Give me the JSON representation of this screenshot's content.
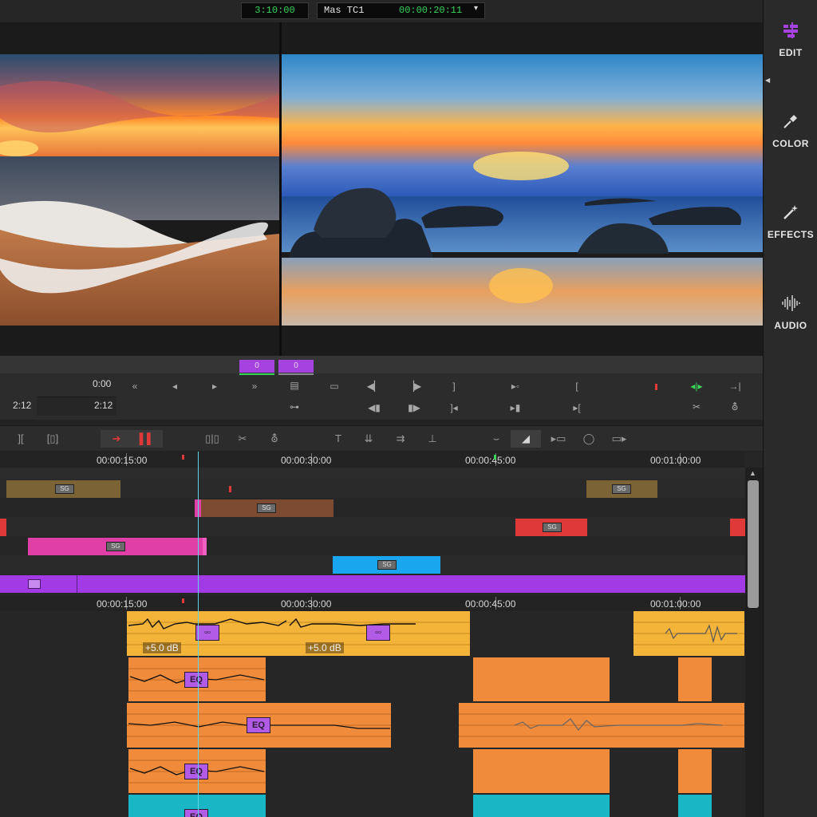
{
  "top_bar": {
    "timecode_current": "3:10:00",
    "master_label": "Mas TC1",
    "master_timecode": "00:00:20:11"
  },
  "right_panel": {
    "items": [
      {
        "label": "EDIT",
        "icon": "edit-tools-icon",
        "active": true
      },
      {
        "label": "COLOR",
        "icon": "eyedropper-icon"
      },
      {
        "label": "EFFECTS",
        "icon": "magic-wand-icon"
      },
      {
        "label": "AUDIO",
        "icon": "waveform-icon"
      }
    ]
  },
  "transport": {
    "source_counter": "0",
    "record_counter": "0",
    "time_a": "0:00",
    "time_b": "2:12",
    "time_c": "2:12"
  },
  "timeline": {
    "ruler_labels": [
      "00:00:15:00",
      "00:00:30:00",
      "00:00:45:00",
      "00:01:00:00"
    ],
    "clip_badge": "SG",
    "audio_gain_1": "+5.0 dB",
    "audio_gain_2": "+5.0 dB",
    "eq_label": "EQ"
  },
  "colors": {
    "accent": "#a642e0",
    "timecode_green": "#39d45a",
    "audio_yellow": "#f4b43a",
    "audio_orange": "#ef8b3b",
    "audio_teal": "#19b6c6",
    "clip_brown": "#7b6335",
    "clip_rust": "#7d4a32",
    "clip_red": "#e0393a",
    "clip_pink": "#df3fa7",
    "clip_blue": "#1aa6ee",
    "clip_purple": "#a23be6",
    "playhead": "#5fd3e8"
  }
}
